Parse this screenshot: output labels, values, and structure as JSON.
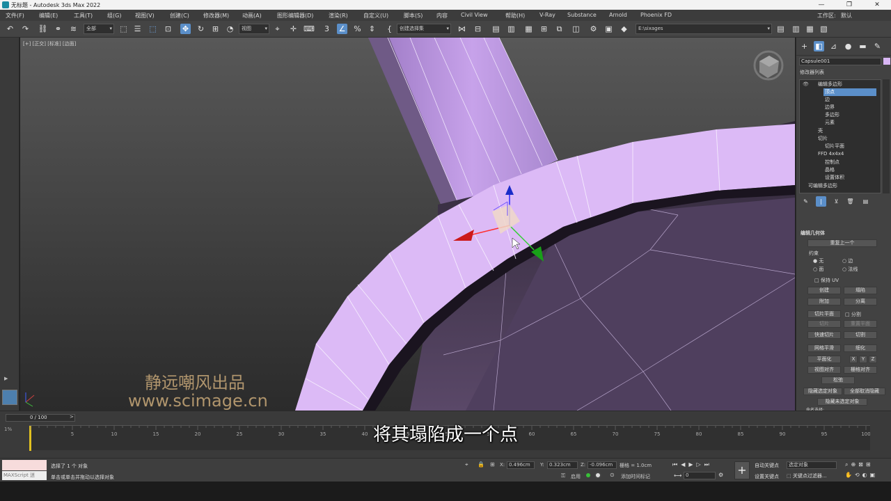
{
  "window": {
    "title": "无标题 - Autodesk 3ds Max 2022",
    "min": "—",
    "max": "❐",
    "close": "✕"
  },
  "menu": [
    "文件(F)",
    "编辑(E)",
    "工具(T)",
    "组(G)",
    "视图(V)",
    "创建(C)",
    "修改器(M)",
    "动画(A)",
    "图形编辑器(D)",
    "渲染(R)",
    "自定义(U)",
    "脚本(S)",
    "内容",
    "Civil View",
    "帮助(H)",
    "V-Ray",
    "Substance",
    "Arnold",
    "Phoenix FD"
  ],
  "workspace": {
    "label": "工作区:",
    "value": "默认"
  },
  "toolbar": {
    "filter": "全部",
    "refcoord": "视图",
    "selset": "创建选择集",
    "path": "E:\\sixages"
  },
  "viewport": {
    "label": "[+] [正交] [标准] [边面]"
  },
  "watermark": {
    "line1": "静远嘲风出品",
    "line2": "www.scimage.cn"
  },
  "subtitle": "将其塌陷成一个点",
  "cmdpanel": {
    "object_name": "Capsule001",
    "modlist_label": "修改器列表",
    "stack": [
      {
        "label": "编辑多边形",
        "indent": 1,
        "selected": false
      },
      {
        "label": "顶点",
        "indent": 3,
        "selected": true
      },
      {
        "label": "边",
        "indent": 3,
        "selected": false
      },
      {
        "label": "边界",
        "indent": 3,
        "selected": false
      },
      {
        "label": "多边形",
        "indent": 3,
        "selected": false
      },
      {
        "label": "元素",
        "indent": 3,
        "selected": false
      },
      {
        "label": "壳",
        "indent": 1,
        "selected": false
      },
      {
        "label": "切片",
        "indent": 1,
        "selected": false
      },
      {
        "label": "切片平面",
        "indent": 3,
        "selected": false
      },
      {
        "label": "FFD 4x4x4",
        "indent": 1,
        "selected": false
      },
      {
        "label": "控制点",
        "indent": 3,
        "selected": false
      },
      {
        "label": "晶格",
        "indent": 3,
        "selected": false
      },
      {
        "label": "设置体积",
        "indent": 3,
        "selected": false
      },
      {
        "label": "可编辑多边形",
        "indent": 1,
        "selected": false
      }
    ],
    "rollout_title": "编辑几何体",
    "repeat_last": "重复上一个",
    "constraint_label": "约束",
    "constraints": [
      "无",
      "边",
      "面",
      "法线"
    ],
    "preserve_uv": "保持 UV",
    "buttons": {
      "create": "创建",
      "collapse": "塌陷",
      "attach": "附加",
      "detach": "分离",
      "slice_plane": "切片平面",
      "split": "分割",
      "slice": "切片",
      "reset_plane": "重置平面",
      "quickslice": "快速切片",
      "cut": "切割",
      "msmooth": "网格平滑",
      "tessellate": "细化",
      "planarize": "平面化",
      "x": "X",
      "y": "Y",
      "z": "Z",
      "view_align": "视图对齐",
      "grid_align": "栅格对齐",
      "relax": "松弛",
      "hide_sel": "隐藏选定对象",
      "unhide_all": "全部取消隐藏",
      "hide_unsel": "隐藏未选定对象",
      "named_sel": "命名选择:"
    }
  },
  "timeline": {
    "frame": "0 / 100",
    "ticks": [
      "0",
      "5",
      "10",
      "15",
      "20",
      "25",
      "30",
      "35",
      "40",
      "45",
      "50",
      "55",
      "60",
      "65",
      "70",
      "75",
      "80",
      "85",
      "90",
      "95",
      "100"
    ]
  },
  "status": {
    "maxscript": "MAXScript 迷",
    "selected": "选择了 1 个 对象",
    "hint": "单击或单击并拖动以选择对象",
    "x": "0.496cm",
    "y": "0.323cm",
    "z": "-0.096cm",
    "grid": "栅格 = 1.0cm",
    "addtime": "添加时间标记",
    "enable": "启用",
    "autokey": "自动关键点",
    "setkey": "设置关键点",
    "keysel": "选定对象",
    "keyfilters": "关键点过滤器...",
    "curframe": "0"
  },
  "colors": {
    "accent": "#5b8fc9",
    "object": "#d8b6f4",
    "object_dark": "#8b6c9e",
    "selected_row": "#5b8fc9"
  }
}
